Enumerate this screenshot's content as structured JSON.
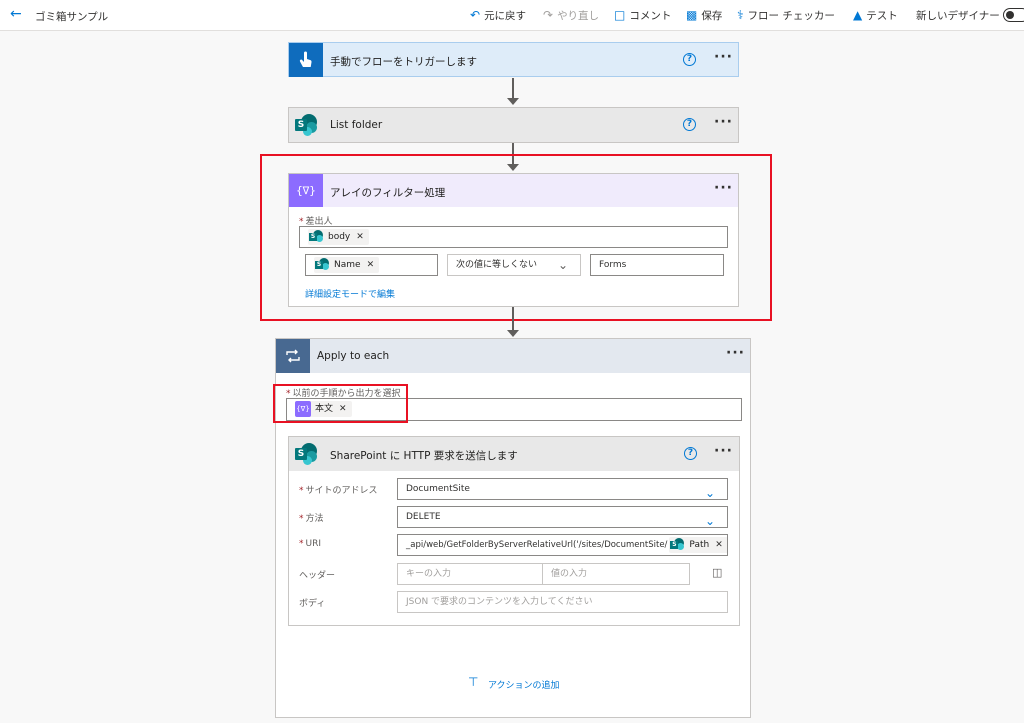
{
  "app": {
    "title": "ゴミ箱サンプル"
  },
  "toolbar": {
    "undo": "元に戻す",
    "redo": "やり直し",
    "comment": "コメント",
    "save": "保存",
    "flow_checker": "フロー チェッカー",
    "test": "テスト",
    "new_designer": "新しいデザイナー"
  },
  "trigger": {
    "title": "手動でフローをトリガーします"
  },
  "list_folder": {
    "title": "List folder"
  },
  "filter": {
    "title": "アレイのフィルター処理",
    "from_label": "差出人",
    "from_token": "body",
    "condition_left_token": "Name",
    "condition_operator": "次の値に等しくない",
    "condition_right": "Forms",
    "advanced_link": "詳細設定モードで編集"
  },
  "apply_each": {
    "title": "Apply to each",
    "select_label": "以前の手順から出力を選択",
    "select_token": "本文",
    "add_action": "アクションの追加"
  },
  "http": {
    "title": "SharePoint に HTTP 要求を送信します",
    "site_label": "サイトのアドレス",
    "site_value": "DocumentSite",
    "method_label": "方法",
    "method_value": "DELETE",
    "uri_label": "URI",
    "uri_prefix": "_api/web/GetFolderByServerRelativeUrl('/sites/DocumentSite/",
    "uri_token": "Path",
    "uri_suffix": "')",
    "headers_label": "ヘッダー",
    "header_key_placeholder": "キーの入力",
    "header_value_placeholder": "値の入力",
    "body_label": "ボディ",
    "body_placeholder": "JSON で要求のコンテンツを入力してください"
  },
  "colors": {
    "trigger_icon": "#0f6cbd",
    "filter_icon": "#8c6cff",
    "loop_icon": "#486991",
    "highlight": "#e81123",
    "accent": "#0078d4"
  }
}
